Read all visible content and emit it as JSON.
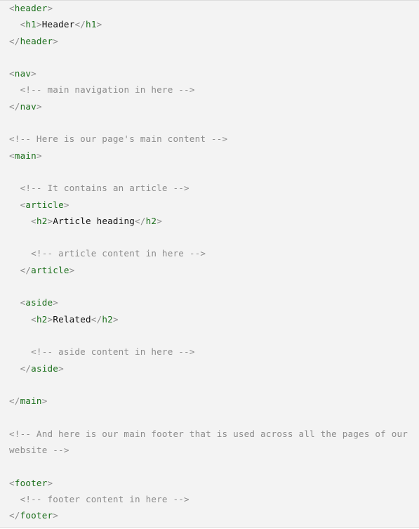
{
  "code_sample": {
    "lines": [
      [
        {
          "k": "p",
          "v": "<"
        },
        {
          "k": "t",
          "v": "header"
        },
        {
          "k": "p",
          "v": ">"
        }
      ],
      [
        {
          "k": "x",
          "v": "  "
        },
        {
          "k": "p",
          "v": "<"
        },
        {
          "k": "t",
          "v": "h1"
        },
        {
          "k": "p",
          "v": ">"
        },
        {
          "k": "x",
          "v": "Header"
        },
        {
          "k": "p",
          "v": "</"
        },
        {
          "k": "t",
          "v": "h1"
        },
        {
          "k": "p",
          "v": ">"
        }
      ],
      [
        {
          "k": "p",
          "v": "</"
        },
        {
          "k": "t",
          "v": "header"
        },
        {
          "k": "p",
          "v": ">"
        }
      ],
      [],
      [
        {
          "k": "p",
          "v": "<"
        },
        {
          "k": "t",
          "v": "nav"
        },
        {
          "k": "p",
          "v": ">"
        }
      ],
      [
        {
          "k": "x",
          "v": "  "
        },
        {
          "k": "c",
          "v": "<!-- main navigation in here -->"
        }
      ],
      [
        {
          "k": "p",
          "v": "</"
        },
        {
          "k": "t",
          "v": "nav"
        },
        {
          "k": "p",
          "v": ">"
        }
      ],
      [],
      [
        {
          "k": "c",
          "v": "<!-- Here is our page's main content -->"
        }
      ],
      [
        {
          "k": "p",
          "v": "<"
        },
        {
          "k": "t",
          "v": "main"
        },
        {
          "k": "p",
          "v": ">"
        }
      ],
      [],
      [
        {
          "k": "x",
          "v": "  "
        },
        {
          "k": "c",
          "v": "<!-- It contains an article -->"
        }
      ],
      [
        {
          "k": "x",
          "v": "  "
        },
        {
          "k": "p",
          "v": "<"
        },
        {
          "k": "t",
          "v": "article"
        },
        {
          "k": "p",
          "v": ">"
        }
      ],
      [
        {
          "k": "x",
          "v": "    "
        },
        {
          "k": "p",
          "v": "<"
        },
        {
          "k": "t",
          "v": "h2"
        },
        {
          "k": "p",
          "v": ">"
        },
        {
          "k": "x",
          "v": "Article heading"
        },
        {
          "k": "p",
          "v": "</"
        },
        {
          "k": "t",
          "v": "h2"
        },
        {
          "k": "p",
          "v": ">"
        }
      ],
      [],
      [
        {
          "k": "x",
          "v": "    "
        },
        {
          "k": "c",
          "v": "<!-- article content in here -->"
        }
      ],
      [
        {
          "k": "x",
          "v": "  "
        },
        {
          "k": "p",
          "v": "</"
        },
        {
          "k": "t",
          "v": "article"
        },
        {
          "k": "p",
          "v": ">"
        }
      ],
      [],
      [
        {
          "k": "x",
          "v": "  "
        },
        {
          "k": "p",
          "v": "<"
        },
        {
          "k": "t",
          "v": "aside"
        },
        {
          "k": "p",
          "v": ">"
        }
      ],
      [
        {
          "k": "x",
          "v": "    "
        },
        {
          "k": "p",
          "v": "<"
        },
        {
          "k": "t",
          "v": "h2"
        },
        {
          "k": "p",
          "v": ">"
        },
        {
          "k": "x",
          "v": "Related"
        },
        {
          "k": "p",
          "v": "</"
        },
        {
          "k": "t",
          "v": "h2"
        },
        {
          "k": "p",
          "v": ">"
        }
      ],
      [],
      [
        {
          "k": "x",
          "v": "    "
        },
        {
          "k": "c",
          "v": "<!-- aside content in here -->"
        }
      ],
      [
        {
          "k": "x",
          "v": "  "
        },
        {
          "k": "p",
          "v": "</"
        },
        {
          "k": "t",
          "v": "aside"
        },
        {
          "k": "p",
          "v": ">"
        }
      ],
      [],
      [
        {
          "k": "p",
          "v": "</"
        },
        {
          "k": "t",
          "v": "main"
        },
        {
          "k": "p",
          "v": ">"
        }
      ],
      [],
      [
        {
          "k": "c",
          "v": "<!-- And here is our main footer that is used across all the pages of our"
        }
      ],
      [
        {
          "k": "c",
          "v": "website -->"
        }
      ],
      [],
      [
        {
          "k": "p",
          "v": "<"
        },
        {
          "k": "t",
          "v": "footer"
        },
        {
          "k": "p",
          "v": ">"
        }
      ],
      [
        {
          "k": "x",
          "v": "  "
        },
        {
          "k": "c",
          "v": "<!-- footer content in here -->"
        }
      ],
      [
        {
          "k": "p",
          "v": "</"
        },
        {
          "k": "t",
          "v": "footer"
        },
        {
          "k": "p",
          "v": ">"
        }
      ]
    ]
  },
  "colors": {
    "background": "#f3f3f3",
    "tag_name": "#1b6f1b",
    "punctuation": "#8a8a8a",
    "comment": "#8c8c8c",
    "text": "#111111"
  }
}
